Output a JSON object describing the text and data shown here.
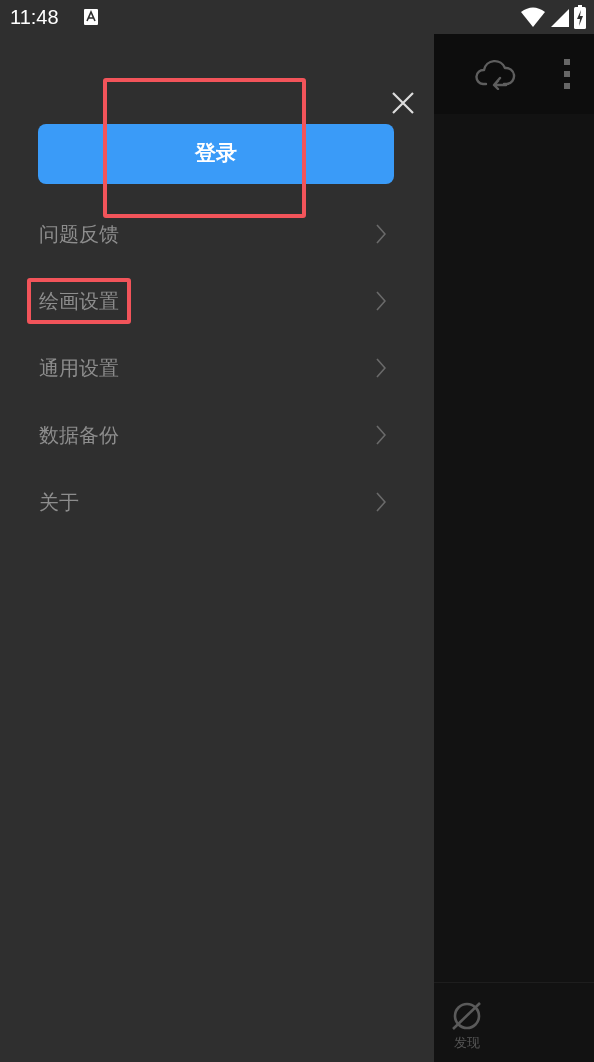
{
  "status_bar": {
    "time": "11:48"
  },
  "drawer": {
    "login_button": {
      "label": "登录",
      "highlighted": true
    },
    "menu_items": [
      {
        "label": "问题反馈",
        "highlighted": false
      },
      {
        "label": "绘画设置",
        "highlighted": true
      },
      {
        "label": "通用设置",
        "highlighted": false
      },
      {
        "label": "数据备份",
        "highlighted": false
      },
      {
        "label": "关于",
        "highlighted": false
      }
    ]
  },
  "bottom_nav": [
    {
      "label": "发现"
    }
  ]
}
